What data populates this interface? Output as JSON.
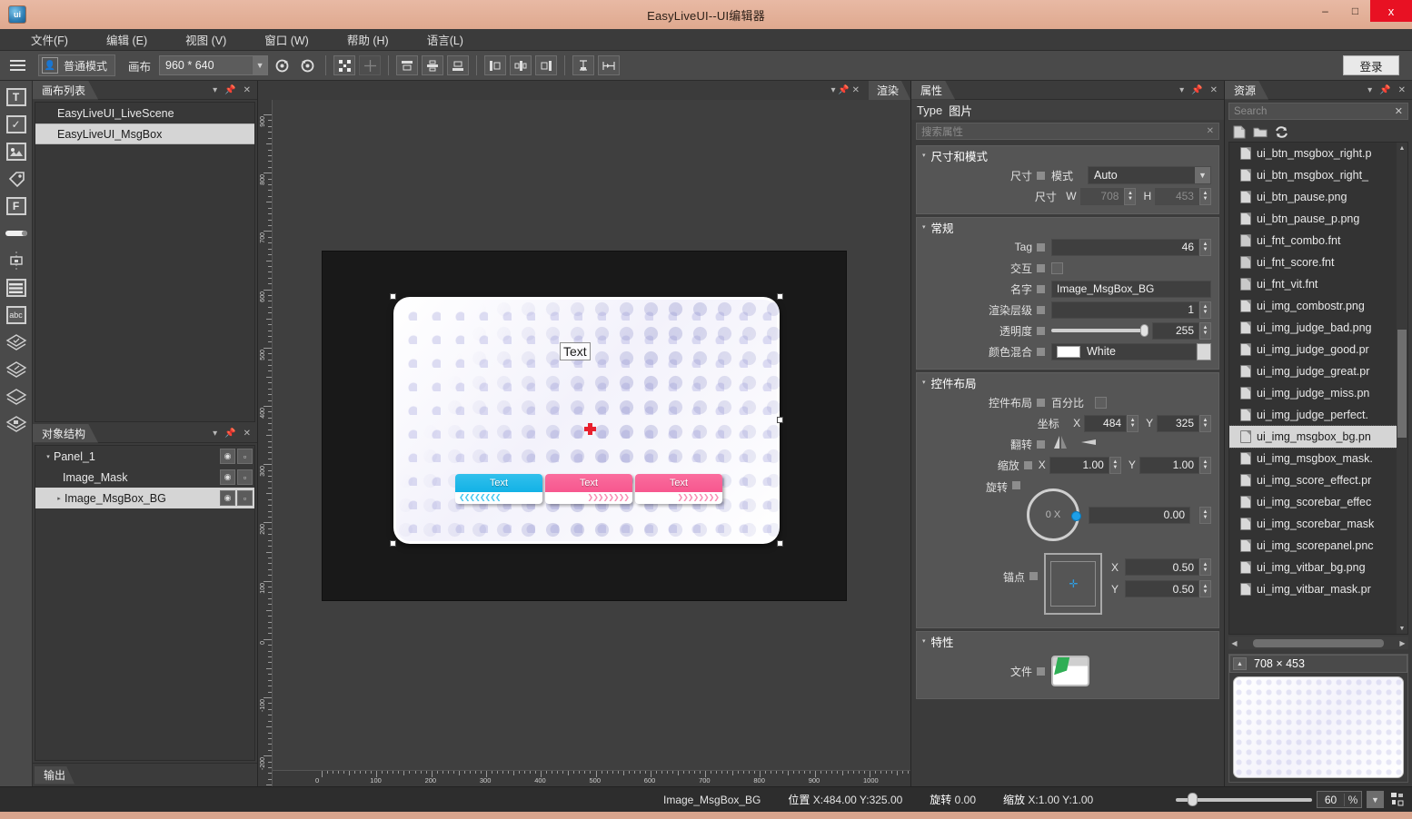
{
  "window": {
    "title": "EasyLiveUI--UI编辑器",
    "app_icon": "ui-logo-icon",
    "minimize": "–",
    "maximize": "□",
    "close": "x"
  },
  "menu": {
    "items": [
      {
        "label": "文件(F)",
        "name": "menu-file"
      },
      {
        "label": "编辑 (E)",
        "name": "menu-edit"
      },
      {
        "label": "视图 (V)",
        "name": "menu-view"
      },
      {
        "label": "窗口 (W)",
        "name": "menu-window"
      },
      {
        "label": "帮助 (H)",
        "name": "menu-help"
      },
      {
        "label": "语言(L)",
        "name": "menu-language"
      }
    ]
  },
  "toolbar": {
    "mode_label": "普通模式",
    "canvas_label": "画布",
    "canvas_size": "960 * 640",
    "login_label": "登录",
    "icons": [
      "hamburger-menu-icon",
      "person-mode-icon",
      "redo-icon",
      "undo-icon",
      "align-center-both-icon",
      "distribute-icon",
      "align-top-icon",
      "align-vcenter-icon",
      "align-bottom-icon",
      "align-left-icon",
      "align-hcenter-icon",
      "align-right-icon",
      "vertical-distribute-icon",
      "horizontal-distribute-icon"
    ]
  },
  "toolstrip": {
    "items": [
      {
        "name": "text-tool",
        "glyph": "T"
      },
      {
        "name": "checkbox-tool",
        "glyph": "✓"
      },
      {
        "name": "image-tool",
        "glyph": "▨"
      },
      {
        "name": "tag-tool",
        "glyph": "◇"
      },
      {
        "name": "font-tool",
        "glyph": "F"
      },
      {
        "name": "slider-tool",
        "glyph": "▭"
      },
      {
        "name": "node-tool",
        "glyph": "⊡"
      },
      {
        "name": "list-tool",
        "glyph": "☰"
      },
      {
        "name": "input-tool",
        "glyph": "abc"
      },
      {
        "name": "layer-tool-1",
        "glyph": "◈"
      },
      {
        "name": "layer-tool-2",
        "glyph": "◈"
      },
      {
        "name": "layer-tool-3",
        "glyph": "◈"
      },
      {
        "name": "layer-tool-4",
        "glyph": "◈"
      }
    ]
  },
  "canvas_list_panel": {
    "title": "画布列表",
    "items": [
      {
        "label": "EasyLiveUI_LiveScene",
        "selected": false
      },
      {
        "label": "EasyLiveUI_MsgBox",
        "selected": true
      }
    ]
  },
  "object_tree_panel": {
    "title": "对象结构",
    "nodes": [
      {
        "label": "Panel_1",
        "indent": 0,
        "arrow": "▾",
        "selected": false
      },
      {
        "label": "Image_Mask",
        "indent": 1,
        "arrow": "",
        "selected": false
      },
      {
        "label": "Image_MsgBox_BG",
        "indent": 1,
        "arrow": "▸",
        "selected": true
      }
    ],
    "eye_icon": "eye-icon",
    "lock_icon": "lock-icon"
  },
  "output_panel": {
    "title": "输出"
  },
  "render_panel": {
    "title": "渲染"
  },
  "canvas": {
    "artboard_text": "Text",
    "buttons": [
      {
        "label": "Text",
        "color": "#12b2e6",
        "style": "blue"
      },
      {
        "label": "Text",
        "color": "#f7578e",
        "style": "pink"
      },
      {
        "label": "Text",
        "color": "#f7578e",
        "style": "pink"
      }
    ],
    "h_ruler_labels": [
      "0",
      "100",
      "200",
      "300",
      "400",
      "500",
      "600",
      "700",
      "800",
      "900",
      "1000"
    ],
    "v_ruler_labels": [
      "900",
      "800",
      "700",
      "600",
      "500",
      "400",
      "300",
      "200",
      "100",
      "0",
      "-100",
      "-200"
    ]
  },
  "properties": {
    "title": "属性",
    "type_label": "Type",
    "type_value": "图片",
    "search_placeholder": "搜索属性",
    "groups": [
      {
        "title": "尺寸和模式",
        "rows": [
          {
            "label": "尺寸",
            "kind": "combo",
            "sub_label": "模式",
            "value": "Auto"
          },
          {
            "label": "",
            "kind": "wh",
            "sub_label": "尺寸",
            "w_label": "W",
            "w": "708",
            "h_label": "H",
            "h": "453"
          }
        ]
      },
      {
        "title": "常规",
        "rows": [
          {
            "label": "Tag",
            "kind": "num",
            "value": "46"
          },
          {
            "label": "交互",
            "kind": "check",
            "value": ""
          },
          {
            "label": "名字",
            "kind": "text",
            "value": "Image_MsgBox_BG"
          },
          {
            "label": "渲染层级",
            "kind": "num",
            "value": "1"
          },
          {
            "label": "透明度",
            "kind": "slider",
            "value": "255"
          },
          {
            "label": "颜色混合",
            "kind": "color",
            "value": "White",
            "swatch": "#ffffff"
          }
        ]
      },
      {
        "title": "控件布局",
        "rows": [
          {
            "label": "控件布局",
            "kind": "percent",
            "sub_label": "百分比"
          },
          {
            "label": "",
            "kind": "xy",
            "sub_label": "坐标",
            "x_label": "X",
            "x": "484",
            "y_label": "Y",
            "y": "325"
          },
          {
            "label": "翻转",
            "kind": "flip"
          },
          {
            "label": "缩放",
            "kind": "scale",
            "x_label": "X",
            "x": "1.00",
            "y_label": "Y",
            "y": "1.00"
          },
          {
            "label": "旋转",
            "kind": "dial",
            "dial_label": "0 X",
            "value": "0.00"
          },
          {
            "label": "锚点",
            "kind": "anchor",
            "x_label": "X",
            "x": "0.50",
            "y_label": "Y",
            "y": "0.50"
          }
        ]
      },
      {
        "title": "特性",
        "rows": [
          {
            "label": "文件",
            "kind": "file"
          }
        ]
      }
    ]
  },
  "resources": {
    "title": "资源",
    "search_placeholder": "Search",
    "tool_icons": [
      "new-file-icon",
      "open-folder-icon",
      "refresh-icon"
    ],
    "files": [
      {
        "label": "ui_btn_msgbox_right.p",
        "type": "png",
        "selected": false
      },
      {
        "label": "ui_btn_msgbox_right_",
        "type": "png",
        "selected": false
      },
      {
        "label": "ui_btn_pause.png",
        "type": "png",
        "selected": false
      },
      {
        "label": "ui_btn_pause_p.png",
        "type": "png",
        "selected": false
      },
      {
        "label": "ui_fnt_combo.fnt",
        "type": "fnt",
        "selected": false
      },
      {
        "label": "ui_fnt_score.fnt",
        "type": "fnt",
        "selected": false
      },
      {
        "label": "ui_fnt_vit.fnt",
        "type": "fnt",
        "selected": false
      },
      {
        "label": "ui_img_combostr.png",
        "type": "png",
        "selected": false
      },
      {
        "label": "ui_img_judge_bad.png",
        "type": "png",
        "selected": false
      },
      {
        "label": "ui_img_judge_good.pr",
        "type": "png",
        "selected": false
      },
      {
        "label": "ui_img_judge_great.pr",
        "type": "png",
        "selected": false
      },
      {
        "label": "ui_img_judge_miss.pn",
        "type": "png",
        "selected": false
      },
      {
        "label": "ui_img_judge_perfect.",
        "type": "png",
        "selected": false
      },
      {
        "label": "ui_img_msgbox_bg.pn",
        "type": "png",
        "selected": true
      },
      {
        "label": "ui_img_msgbox_mask.",
        "type": "png",
        "selected": false
      },
      {
        "label": "ui_img_score_effect.pr",
        "type": "png",
        "selected": false
      },
      {
        "label": "ui_img_scorebar_effec",
        "type": "png",
        "selected": false
      },
      {
        "label": "ui_img_scorebar_mask",
        "type": "png",
        "selected": false
      },
      {
        "label": "ui_img_scorepanel.pnc",
        "type": "png",
        "selected": false
      },
      {
        "label": "ui_img_vitbar_bg.png",
        "type": "png",
        "selected": false
      },
      {
        "label": "ui_img_vitbar_mask.pr",
        "type": "png",
        "selected": false
      }
    ]
  },
  "preview": {
    "dimensions": "708  ×  453"
  },
  "statusbar": {
    "object_name": "Image_MsgBox_BG",
    "position_label": "位置",
    "position_value": "X:484.00   Y:325.00",
    "rotation_label": "旋转",
    "rotation_value": "0.00",
    "scale_label": "缩放",
    "scale_value": "X:1.00   Y:1.00",
    "zoom_value": "60",
    "zoom_unit": "%"
  }
}
